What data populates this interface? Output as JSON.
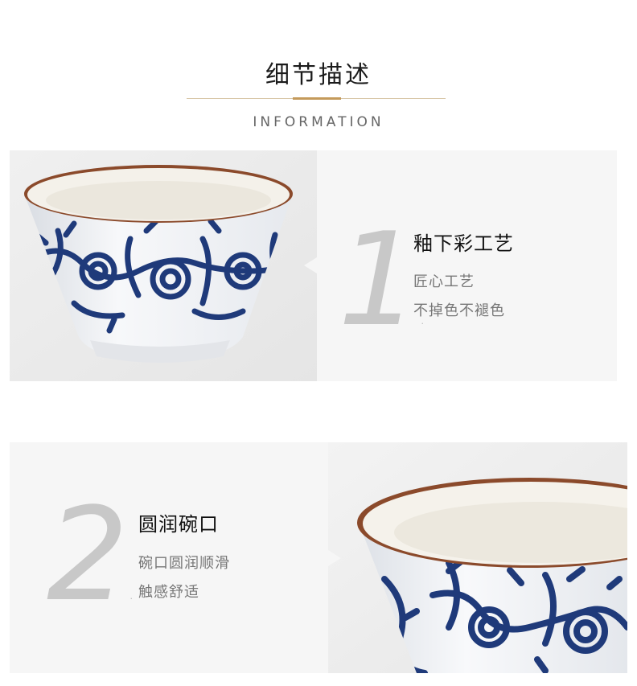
{
  "header": {
    "title": "细节描述",
    "subtitle": "INFORMATION"
  },
  "sections": [
    {
      "number": "1",
      "dot": ".",
      "title": "釉下彩工艺",
      "lines": [
        "匠心工艺",
        "不掉色不褪色"
      ]
    },
    {
      "number": "2",
      "dot": ".",
      "title": "圆润碗口",
      "lines": [
        "碗口圆润顺滑",
        "触感舒适"
      ]
    }
  ],
  "colors": {
    "accent_gold": "#c49a5b",
    "glaze_blue": "#1f3a7a",
    "rim_brown": "#8b4a2b",
    "panel_bg": "#f6f6f6"
  }
}
